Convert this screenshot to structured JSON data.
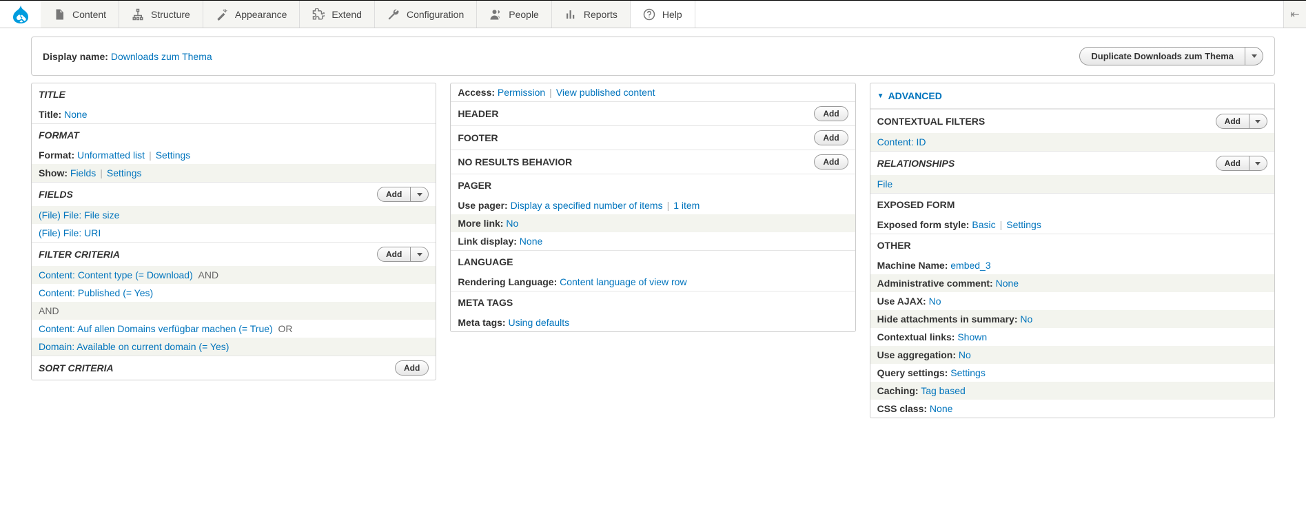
{
  "toolbar": {
    "items": [
      {
        "id": "content",
        "label": "Content"
      },
      {
        "id": "structure",
        "label": "Structure"
      },
      {
        "id": "appearance",
        "label": "Appearance"
      },
      {
        "id": "extend",
        "label": "Extend"
      },
      {
        "id": "configuration",
        "label": "Configuration"
      },
      {
        "id": "people",
        "label": "People"
      },
      {
        "id": "reports",
        "label": "Reports"
      },
      {
        "id": "help",
        "label": "Help"
      }
    ]
  },
  "display": {
    "label": "Display name:",
    "value": "Downloads zum Thema",
    "duplicate_btn": "Duplicate Downloads zum Thema"
  },
  "col1": {
    "title_h": "TITLE",
    "title_k": "Title:",
    "title_v": "None",
    "format_h": "FORMAT",
    "format_k": "Format:",
    "format_v": "Unformatted list",
    "format_settings": "Settings",
    "show_k": "Show:",
    "show_v": "Fields",
    "show_settings": "Settings",
    "fields_h": "FIELDS",
    "fields_add": "Add",
    "fields": [
      "(File) File: File size",
      "(File) File: URI"
    ],
    "filter_h": "FILTER CRITERIA",
    "filter_add": "Add",
    "filters": {
      "f0": "Content: Content type (= Download)",
      "and0": "AND",
      "f1": "Content: Published (= Yes)",
      "and1": "AND",
      "f2": "Content: Auf allen Domains verfügbar machen (= True)",
      "or2": "OR",
      "f3": "Domain: Available on current domain (= Yes)"
    },
    "sort_h": "SORT CRITERIA",
    "sort_add": "Add"
  },
  "col2": {
    "access_k": "Access:",
    "access_v": "Permission",
    "access_v2": "View published content",
    "header_h": "HEADER",
    "header_add": "Add",
    "footer_h": "FOOTER",
    "footer_add": "Add",
    "nores_h": "NO RESULTS BEHAVIOR",
    "nores_add": "Add",
    "pager_h": "PAGER",
    "pager_k": "Use pager:",
    "pager_v": "Display a specified number of items",
    "pager_v2": "1 item",
    "more_k": "More link:",
    "more_v": "No",
    "linkd_k": "Link display:",
    "linkd_v": "None",
    "lang_h": "LANGUAGE",
    "rlang_k": "Rendering Language:",
    "rlang_v": "Content language of view row",
    "meta_h": "META TAGS",
    "meta_k": "Meta tags:",
    "meta_v": "Using defaults"
  },
  "col3": {
    "adv_h": "ADVANCED",
    "ctx_h": "CONTEXTUAL FILTERS",
    "ctx_add": "Add",
    "ctx_item": "Content: ID",
    "rel_h": "RELATIONSHIPS",
    "rel_add": "Add",
    "rel_item": "File",
    "exp_h": "EXPOSED FORM",
    "exp_k": "Exposed form style:",
    "exp_v": "Basic",
    "exp_s": "Settings",
    "oth_h": "OTHER",
    "mn_k": "Machine Name:",
    "mn_v": "embed_3",
    "ac_k": "Administrative comment:",
    "ac_v": "None",
    "ajax_k": "Use AJAX:",
    "ajax_v": "No",
    "hide_k": "Hide attachments in summary:",
    "hide_v": "No",
    "cl_k": "Contextual links:",
    "cl_v": "Shown",
    "agg_k": "Use aggregation:",
    "agg_v": "No",
    "qs_k": "Query settings:",
    "qs_v": "Settings",
    "cache_k": "Caching:",
    "cache_v": "Tag based",
    "css_k": "CSS class:",
    "css_v": "None"
  }
}
